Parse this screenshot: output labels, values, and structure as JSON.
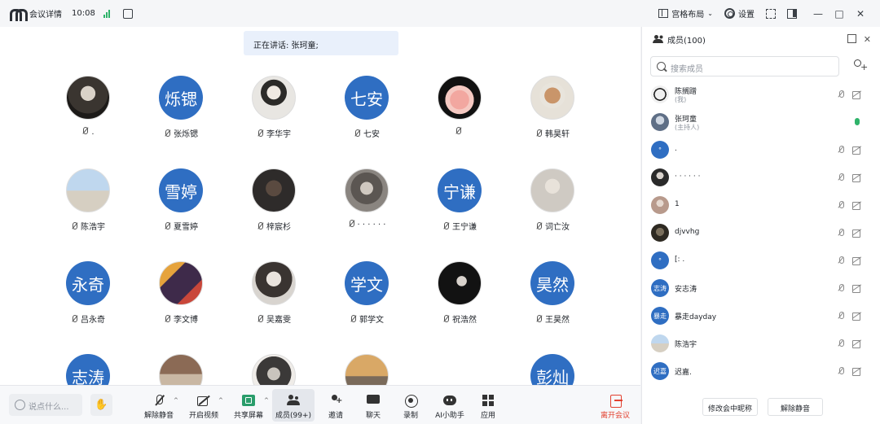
{
  "titlebar": {
    "title": "会议详情",
    "time": "10:08",
    "layout_label": "宫格布局",
    "settings_label": "设置"
  },
  "speaking_banner": "正在讲话: 张珂童;",
  "participants": [
    {
      "name": ".",
      "avatar_text": ""
    },
    {
      "name": "张烁锶",
      "avatar_text": "烁锶"
    },
    {
      "name": "李华宇",
      "avatar_text": ""
    },
    {
      "name": "七安",
      "avatar_text": "七安"
    },
    {
      "name": "",
      "avatar_text": ""
    },
    {
      "name": "韩昊轩",
      "avatar_text": ""
    },
    {
      "name": "陈浩宇",
      "avatar_text": ""
    },
    {
      "name": "夏雪婷",
      "avatar_text": "雪婷"
    },
    {
      "name": "梓宸杉",
      "avatar_text": ""
    },
    {
      "name": "· · · · · ·",
      "avatar_text": ""
    },
    {
      "name": "王宁谦",
      "avatar_text": "宁谦"
    },
    {
      "name": "词亡汝",
      "avatar_text": ""
    },
    {
      "name": "吕永奇",
      "avatar_text": "永奇"
    },
    {
      "name": "李文博",
      "avatar_text": ""
    },
    {
      "name": "吴嘉雯",
      "avatar_text": ""
    },
    {
      "name": "郭学文",
      "avatar_text": "学文"
    },
    {
      "name": "祝浩然",
      "avatar_text": ""
    },
    {
      "name": "王昊然",
      "avatar_text": "昊然"
    },
    {
      "name": "",
      "avatar_text": "志涛"
    },
    {
      "name": "",
      "avatar_text": ""
    },
    {
      "name": "",
      "avatar_text": ""
    },
    {
      "name": "",
      "avatar_text": ""
    },
    {
      "name": "",
      "avatar_text": "彭灿"
    }
  ],
  "toolbar": {
    "chat_placeholder": "说点什么...",
    "unmute": "解除静音",
    "video": "开启视频",
    "share": "共享屏幕",
    "members": "成员(99+)",
    "invite": "邀请",
    "chat": "聊天",
    "record": "录制",
    "ai": "AI小助手",
    "apps": "应用",
    "leave": "离开会议"
  },
  "panel": {
    "title": "成员(100)",
    "search_placeholder": "搜索成员",
    "members": [
      {
        "name": "陈搁蹭",
        "sub": "(我)",
        "avatar_text": "",
        "mic_on": false
      },
      {
        "name": "张珂童",
        "sub": "(主持人)",
        "avatar_text": "",
        "mic_on": true
      },
      {
        "name": ".",
        "sub": "",
        "avatar_text": "°",
        "mic_on": false
      },
      {
        "name": "· · · · · ·",
        "sub": "",
        "avatar_text": "",
        "mic_on": false
      },
      {
        "name": "1",
        "sub": "",
        "avatar_text": "",
        "mic_on": false
      },
      {
        "name": "djvvhg",
        "sub": "",
        "avatar_text": "",
        "mic_on": false
      },
      {
        "name": "[: .",
        "sub": "",
        "avatar_text": "°",
        "mic_on": false
      },
      {
        "name": "安志涛",
        "sub": "",
        "avatar_text": "志涛",
        "mic_on": false
      },
      {
        "name": "暴走dayday",
        "sub": "",
        "avatar_text": "暴走",
        "mic_on": false
      },
      {
        "name": "陈浩宇",
        "sub": "",
        "avatar_text": "",
        "mic_on": false
      },
      {
        "name": "迟嘉.",
        "sub": "",
        "avatar_text": "迟嘉",
        "mic_on": false
      }
    ],
    "rename_button": "修改会中昵称",
    "unmute_all_button": "解除静音"
  }
}
